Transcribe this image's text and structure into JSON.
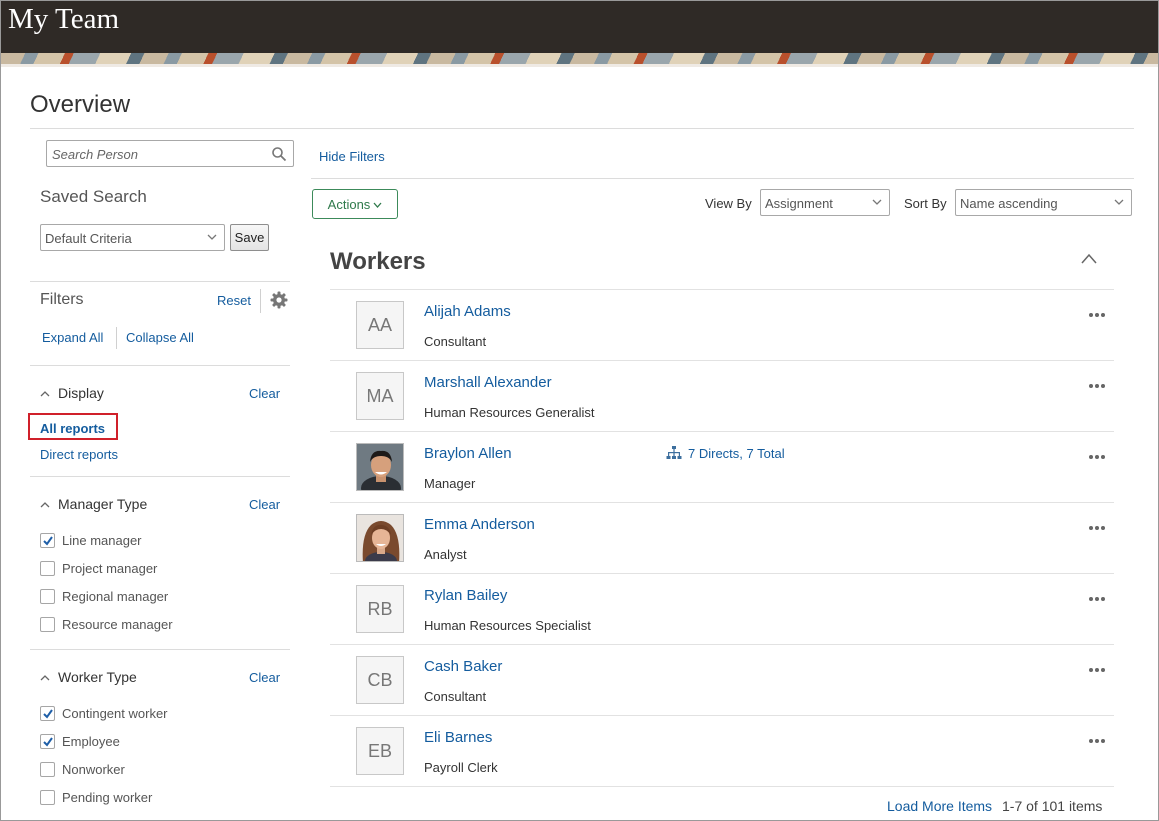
{
  "app": {
    "title": "My Team"
  },
  "page": {
    "title": "Overview"
  },
  "search": {
    "placeholder": "Search Person",
    "hide_filters_label": "Hide Filters"
  },
  "saved_search": {
    "title": "Saved Search",
    "selected": "Default Criteria",
    "save_label": "Save"
  },
  "filters": {
    "title": "Filters",
    "reset_label": "Reset",
    "expand_all_label": "Expand All",
    "collapse_all_label": "Collapse All",
    "clear_label": "Clear",
    "display": {
      "title": "Display",
      "options": [
        "All reports",
        "Direct reports"
      ],
      "selected": "All reports"
    },
    "manager_type": {
      "title": "Manager Type",
      "options": [
        {
          "label": "Line manager",
          "checked": true
        },
        {
          "label": "Project manager",
          "checked": false
        },
        {
          "label": "Regional manager",
          "checked": false
        },
        {
          "label": "Resource manager",
          "checked": false
        }
      ]
    },
    "worker_type": {
      "title": "Worker Type",
      "options": [
        {
          "label": "Contingent worker",
          "checked": true
        },
        {
          "label": "Employee",
          "checked": true
        },
        {
          "label": "Nonworker",
          "checked": false
        },
        {
          "label": "Pending worker",
          "checked": false
        }
      ]
    }
  },
  "toolbar": {
    "actions_label": "Actions",
    "view_by_label": "View By",
    "view_by_value": "Assignment",
    "sort_by_label": "Sort By",
    "sort_by_value": "Name ascending"
  },
  "workers": {
    "title": "Workers",
    "items": [
      {
        "initials": "AA",
        "name": "Alijah Adams",
        "job": "Consultant",
        "photo": false
      },
      {
        "initials": "MA",
        "name": "Marshall Alexander",
        "job": "Human Resources Generalist",
        "photo": false
      },
      {
        "initials": "",
        "name": "Braylon Allen",
        "job": "Manager",
        "photo": true,
        "directs": "7 Directs",
        "total": "7 Total"
      },
      {
        "initials": "",
        "name": "Emma Anderson",
        "job": "Analyst",
        "photo": true
      },
      {
        "initials": "RB",
        "name": "Rylan Bailey",
        "job": "Human Resources Specialist",
        "photo": false
      },
      {
        "initials": "CB",
        "name": "Cash Baker",
        "job": "Consultant",
        "photo": false
      },
      {
        "initials": "EB",
        "name": "Eli Barnes",
        "job": "Payroll Clerk",
        "photo": false
      }
    ],
    "load_more_label": "Load More Items",
    "count_label": "1-7 of 101 items"
  },
  "colors": {
    "link": "#145c9e",
    "header": "#2f2a26",
    "actions_border": "#3c8a5a",
    "highlight": "#d0202a"
  }
}
